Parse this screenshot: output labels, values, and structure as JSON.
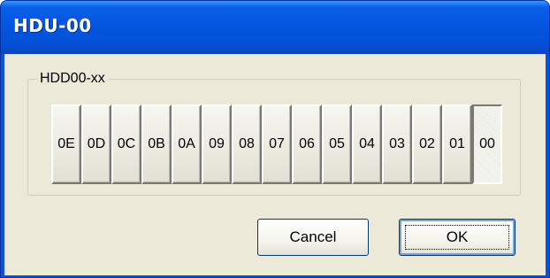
{
  "window": {
    "title": "HDU-00"
  },
  "group": {
    "label": "HDD00-xx",
    "buttons": [
      "0E",
      "0D",
      "0C",
      "0B",
      "0A",
      "09",
      "08",
      "07",
      "06",
      "05",
      "04",
      "03",
      "02",
      "01",
      "00"
    ],
    "selected": "00"
  },
  "actions": {
    "cancel_label": "Cancel",
    "ok_label": "OK"
  },
  "colors": {
    "titlebar": "#0a5fe8",
    "client_bg": "#ece9d8",
    "button_border": "#003c74"
  }
}
